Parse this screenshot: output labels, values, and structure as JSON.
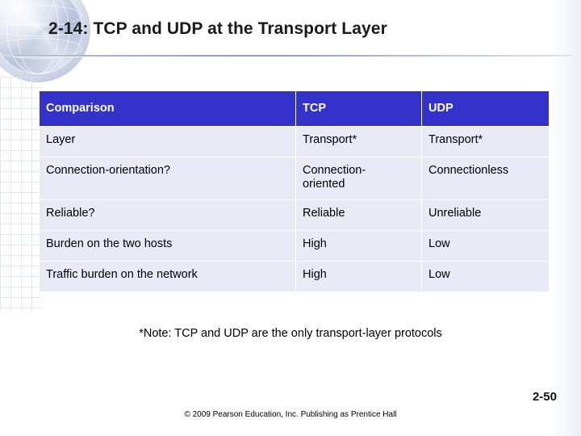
{
  "slide": {
    "title": "2-14: TCP and UDP at the Transport Layer",
    "note": "*Note: TCP and UDP are the only transport-layer protocols",
    "number": "2-50",
    "copyright": "© 2009 Pearson Education, Inc.  Publishing as Prentice Hall"
  },
  "table": {
    "headers": [
      "Comparison",
      "TCP",
      "UDP"
    ],
    "rows": [
      [
        "Layer",
        "Transport*",
        "Transport*"
      ],
      [
        "Connection-orientation?",
        "Connection-\noriented",
        "Connectionless"
      ],
      [
        "Reliable?",
        "Reliable",
        "Unreliable"
      ],
      [
        "Burden on the two hosts",
        "High",
        "Low"
      ],
      [
        "Traffic burden on the network",
        "High",
        "Low"
      ]
    ]
  },
  "decor": {
    "header_fill": "#3333CC",
    "cell_fill": "#E8EAF6"
  }
}
